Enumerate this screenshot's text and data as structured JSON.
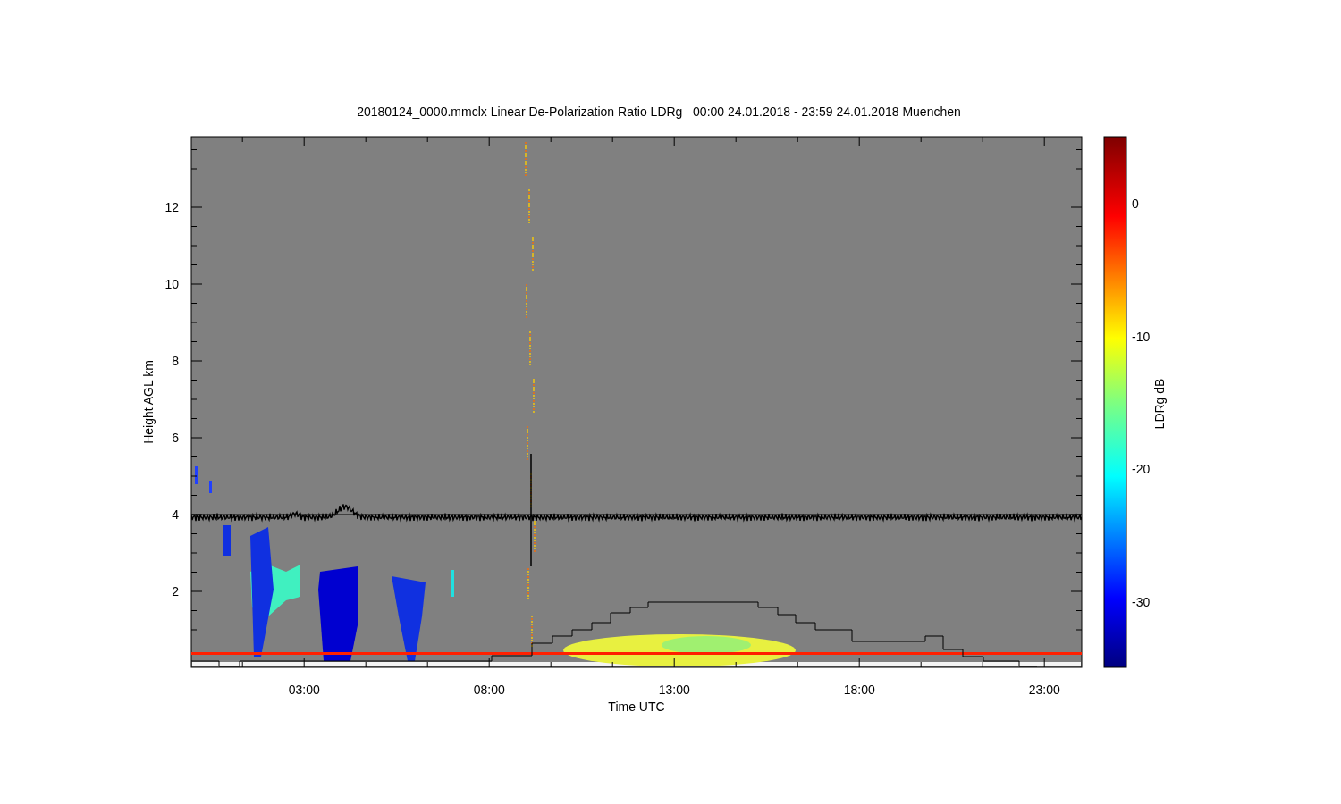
{
  "title": "20180124_0000.mmclx Linear De-Polarization Ratio LDRg   00:00 24.01.2018 - 23:59 24.01.2018 Muenchen",
  "plot": {
    "xlabel": "Time UTC",
    "ylabel": "Height AGL km",
    "xticks": [
      "03:00",
      "08:00",
      "13:00",
      "18:00",
      "23:00"
    ],
    "yticks": [
      "12",
      "10",
      "8",
      "6",
      "4",
      "2"
    ]
  },
  "colorbar": {
    "label": "LDRg dB",
    "ticks": [
      "0",
      "-10",
      "-20",
      "-30"
    ]
  }
}
